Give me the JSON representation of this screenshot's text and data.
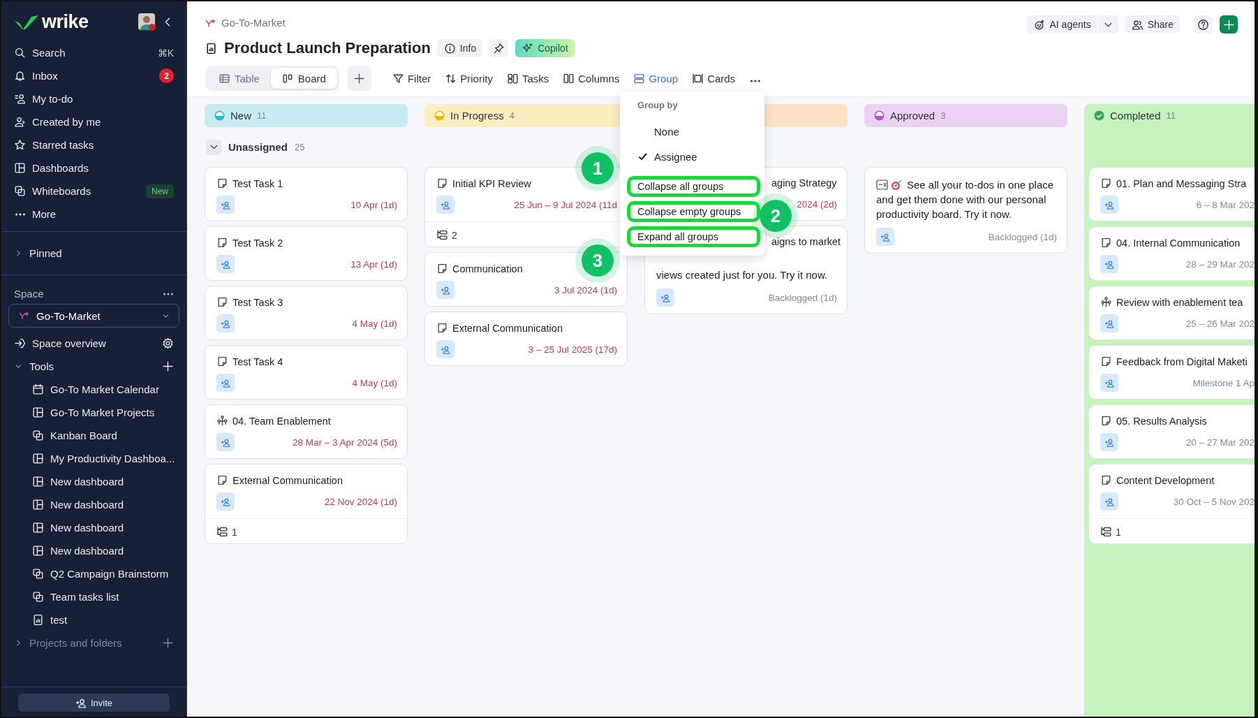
{
  "sidebar": {
    "logo": "wrike",
    "nav": [
      {
        "label": "Search",
        "kind": "search",
        "shortcut": "⌘K"
      },
      {
        "label": "Inbox",
        "kind": "bell",
        "badge": "2"
      },
      {
        "label": "My to-do",
        "kind": "todo"
      },
      {
        "label": "Created by me",
        "kind": "user"
      },
      {
        "label": "Starred tasks",
        "kind": "star"
      },
      {
        "label": "Dashboards",
        "kind": "dashboard"
      },
      {
        "label": "Whiteboards",
        "kind": "whiteboard",
        "tag": "New"
      },
      {
        "label": "More",
        "kind": "dots"
      }
    ],
    "pinned": {
      "label": "Pinned",
      "expanded": false
    },
    "space": {
      "label": "Space",
      "selector": "Go-To-Market",
      "overview": "Space overview"
    },
    "tools": {
      "label": "Tools",
      "expanded": true,
      "children": [
        {
          "label": "Go-To Market Calendar",
          "kind": "calendar"
        },
        {
          "label": "Go-To Market Projects",
          "kind": "dashboard"
        },
        {
          "label": "Kanban Board",
          "kind": "whiteboard"
        },
        {
          "label": "My Productivity Dashboa...",
          "kind": "dashboard"
        },
        {
          "label": "New dashboard",
          "kind": "dashboard"
        },
        {
          "label": "New dashboard",
          "kind": "dashboard"
        },
        {
          "label": "New dashboard",
          "kind": "dashboard"
        },
        {
          "label": "New dashboard",
          "kind": "dashboard"
        },
        {
          "label": "Q2 Campaign Brainstorm",
          "kind": "whiteboard"
        },
        {
          "label": "Team tasks list",
          "kind": "whiteboard"
        },
        {
          "label": "test",
          "kind": "report"
        }
      ]
    },
    "projects": {
      "label": "Projects and folders",
      "expanded": false,
      "disabled": true
    },
    "invite": "Invite"
  },
  "header": {
    "breadcrumb": "Go-To-Market",
    "title": "Product Launch Preparation",
    "info": "Info",
    "copilot": "Copilot",
    "ai_agents": "AI agents",
    "share": "Share"
  },
  "tabs": [
    {
      "label": "Table",
      "kind": "table",
      "selected": false
    },
    {
      "label": "Board",
      "kind": "board",
      "selected": true
    }
  ],
  "toolbar": [
    {
      "label": "Filter",
      "kind": "filter",
      "selected": false
    },
    {
      "label": "Priority",
      "kind": "sort",
      "selected": false
    },
    {
      "label": "Tasks",
      "kind": "tasks",
      "selected": false
    },
    {
      "label": "Columns",
      "kind": "columns",
      "selected": false
    },
    {
      "label": "Group",
      "kind": "group",
      "selected": true
    },
    {
      "label": "Cards",
      "kind": "cards",
      "selected": false
    }
  ],
  "group": {
    "label": "Unassigned",
    "count": "25",
    "expanded": true
  },
  "columns": [
    {
      "name": "New",
      "count": "11",
      "kind": "half",
      "color": "#2bb7d3",
      "cards": [
        {
          "title": "Test Task 1",
          "kind": "task",
          "add_assignee": true,
          "date": "10 Apr (1d)",
          "overdue": true
        },
        {
          "title": "Test Task 2",
          "kind": "task",
          "add_assignee": true,
          "date": "13 Apr (1d)",
          "overdue": true
        },
        {
          "title": "Test Task 3",
          "kind": "task",
          "add_assignee": true,
          "date": "4 May (1d)",
          "overdue": true
        },
        {
          "title": "Test Task 4",
          "kind": "task",
          "add_assignee": true,
          "date": "4 May (1d)",
          "overdue": true
        },
        {
          "title": "04. Team Enablement",
          "kind": "milestone",
          "add_assignee": true,
          "date": "28 Mar – 3 Apr 2024 (5d)",
          "overdue": true
        },
        {
          "title": "External Communication",
          "kind": "task",
          "add_assignee": true,
          "date": "22 Nov 2024 (1d)",
          "overdue": true,
          "subtasks": "1"
        }
      ]
    },
    {
      "name": "In Progress",
      "count": "4",
      "kind": "half",
      "color": "#f2b705",
      "cards": [
        {
          "title": "Initial KPI Review",
          "kind": "task",
          "add_assignee": true,
          "date": "25 Jun – 9 Jul 2024 (11d",
          "overdue": true,
          "subtasks": "2"
        },
        {
          "title": "Communication",
          "kind": "task",
          "add_assignee": true,
          "date": "3 Jul 2024 (1d)",
          "overdue": true
        },
        {
          "title": "External Communication",
          "kind": "task",
          "add_assignee": true,
          "date": "3 – 25 Jul 2025 (17d)",
          "overdue": true
        }
      ]
    },
    {
      "color": "#fde3c4",
      "cards": [
        {
          "title": "aging Strategy",
          "kind": "partial",
          "add_assignee": false,
          "date": "2024 (2d)",
          "overdue": true
        },
        {
          "title": "aigns to market",
          "kind": "partial",
          "add_assignee": true,
          "description": "views created just for you. Try it now.",
          "status": "Backlogged (1d)"
        }
      ]
    },
    {
      "name": "Approved",
      "count": "3",
      "kind": "half",
      "color": "#b84fd6",
      "cards": [
        {
          "kind": "note",
          "description": "See all your to-dos in one place and get them done with our personal productivity board. Try it now.",
          "add_assignee": true,
          "status": "Backlogged (1d)"
        }
      ]
    },
    {
      "name": "Completed",
      "count": "11",
      "kind": "check",
      "color": "#34a853",
      "cards": [
        {
          "title": "01. Plan and Messaging Stra",
          "kind": "task",
          "add_assignee": true,
          "date": "6 – 8 Mar 202",
          "overdue": false
        },
        {
          "title": "04. Internal Communication",
          "kind": "task",
          "add_assignee": true,
          "date": "28 – 29 Mar 202",
          "overdue": false
        },
        {
          "title": "Review with enablement tea",
          "kind": "milestone",
          "add_assignee": true,
          "date": "25 – 26 Mar 202",
          "overdue": false
        },
        {
          "title": "Feedback from Digital Maketi",
          "kind": "task",
          "add_assignee": true,
          "date": "Milestone 1 Ap",
          "overdue": false
        },
        {
          "title": "05. Results Analysis",
          "kind": "task",
          "add_assignee": true,
          "date": "20 – 27 Mar 202",
          "overdue": false
        },
        {
          "title": "Content Development",
          "kind": "task",
          "add_assignee": true,
          "date": "30 Oct – 5 Nov 202",
          "overdue": false,
          "subtasks": "1"
        }
      ]
    }
  ],
  "menu": {
    "heading": "Group by",
    "options": [
      {
        "label": "None",
        "selected": false
      },
      {
        "label": "Assignee",
        "selected": true
      }
    ],
    "actions": [
      {
        "label": "Collapse all groups",
        "highlighted": true,
        "step": "1"
      },
      {
        "label": "Collapse empty groups",
        "highlighted": true,
        "step": "2"
      },
      {
        "label": "Expand all groups",
        "highlighted": true,
        "step": "3"
      }
    ]
  }
}
